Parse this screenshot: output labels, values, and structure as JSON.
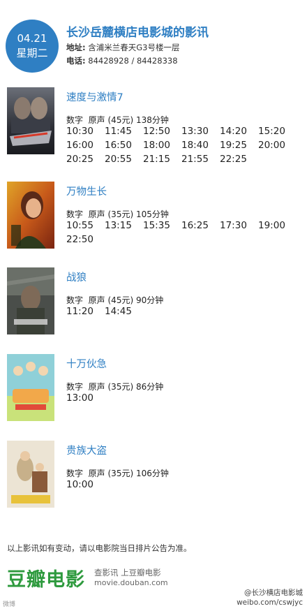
{
  "header": {
    "date": "04.21",
    "weekday": "星期二",
    "title": "长沙岳麓横店电影城的影讯",
    "address_label": "地址:",
    "address": "含浦米兰春天G3号楼一层",
    "phone_label": "电话:",
    "phone": "84428928 / 84428338"
  },
  "movies": [
    {
      "title": "速度与激情7",
      "format": "数字",
      "language": "原声",
      "price": "(45元)",
      "duration": "138分钟",
      "times": [
        "10:30",
        "11:45",
        "12:50",
        "13:30",
        "14:20",
        "15:20",
        "16:00",
        "16:50",
        "18:00",
        "18:40",
        "19:25",
        "20:00",
        "20:25",
        "20:55",
        "21:15",
        "21:55",
        "22:25"
      ]
    },
    {
      "title": "万物生长",
      "format": "数字",
      "language": "原声",
      "price": "(35元)",
      "duration": "105分钟",
      "times": [
        "10:55",
        "13:15",
        "15:35",
        "16:25",
        "17:30",
        "19:00",
        "22:50"
      ]
    },
    {
      "title": "战狼",
      "format": "数字",
      "language": "原声",
      "price": "(45元)",
      "duration": "90分钟",
      "times": [
        "11:20",
        "14:45"
      ]
    },
    {
      "title": "十万伙急",
      "format": "数字",
      "language": "原声",
      "price": "(35元)",
      "duration": "86分钟",
      "times": [
        "13:00"
      ]
    },
    {
      "title": "贵族大盗",
      "format": "数字",
      "language": "原声",
      "price": "(35元)",
      "duration": "106分钟",
      "times": [
        "10:00"
      ]
    }
  ],
  "footer": {
    "note": "以上影讯如有变动，请以电影院当日排片公告为准。",
    "logo": "豆瓣电影",
    "slogan": "查影讯  上豆瓣电影",
    "url": "movie.douban.com",
    "watermark_handle": "@长沙横店电影城",
    "watermark_url": "weibo.com/cswjyc",
    "watermark_left": "微博"
  },
  "colors": {
    "accent": "#2f7fc3",
    "brand_green": "#2e9a3e"
  }
}
